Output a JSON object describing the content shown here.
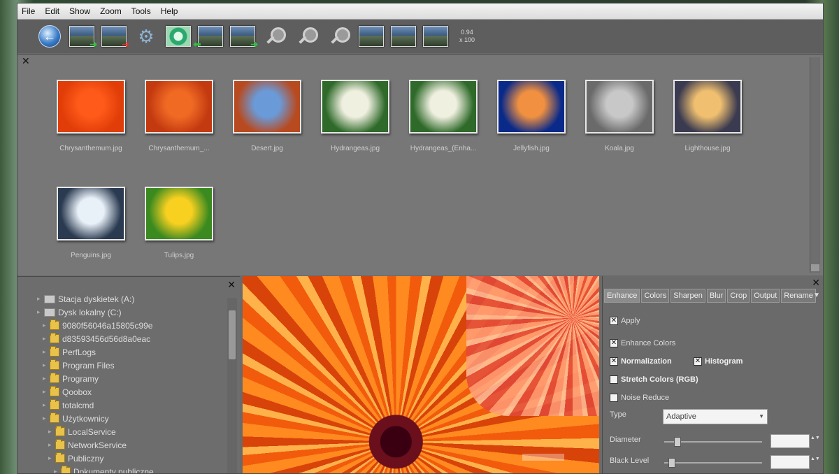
{
  "menu": [
    "File",
    "Edit",
    "Show",
    "Zoom",
    "Tools",
    "Help"
  ],
  "thumbnails": [
    {
      "label": "Chrysanthemum.jpg",
      "colors": [
        "#ff5a1a",
        "#e03d08"
      ]
    },
    {
      "label": "Chrysanthemum_...",
      "colors": [
        "#f06a24",
        "#c43a10"
      ]
    },
    {
      "label": "Desert.jpg",
      "colors": [
        "#6a9ad8",
        "#b84a20"
      ]
    },
    {
      "label": "Hydrangeas.jpg",
      "colors": [
        "#f0f0e0",
        "#2f6a2a"
      ]
    },
    {
      "label": "Hydrangeas_(Enha...",
      "colors": [
        "#f0f0e0",
        "#2f6a2a"
      ]
    },
    {
      "label": "Jellyfish.jpg",
      "colors": [
        "#f09040",
        "#0a2a8a"
      ]
    },
    {
      "label": "Koala.jpg",
      "colors": [
        "#c8c8c8",
        "#6a6a6a"
      ]
    },
    {
      "label": "Lighthouse.jpg",
      "colors": [
        "#f0c070",
        "#3a3a50"
      ]
    },
    {
      "label": "Penguins.jpg",
      "colors": [
        "#e8f0f8",
        "#2a3a50"
      ]
    },
    {
      "label": "Tulips.jpg",
      "colors": [
        "#f8d020",
        "#3a8a20"
      ]
    }
  ],
  "tree": [
    {
      "label": "Stacja dyskietek (A:)",
      "type": "drive",
      "indent": 1
    },
    {
      "label": "Dysk lokalny (C:)",
      "type": "drive",
      "indent": 1
    },
    {
      "label": "9080f56046a15805c99e",
      "type": "folder",
      "indent": 2
    },
    {
      "label": "d83593456d56d8a0eac",
      "type": "folder",
      "indent": 2
    },
    {
      "label": "PerfLogs",
      "type": "folder",
      "indent": 2
    },
    {
      "label": "Program Files",
      "type": "folder",
      "indent": 2
    },
    {
      "label": "Programy",
      "type": "folder",
      "indent": 2
    },
    {
      "label": "Qoobox",
      "type": "folder",
      "indent": 2
    },
    {
      "label": "totalcmd",
      "type": "folder",
      "indent": 2
    },
    {
      "label": "Użytkownicy",
      "type": "folder",
      "indent": 2
    },
    {
      "label": "LocalService",
      "type": "folder",
      "indent": 3
    },
    {
      "label": "NetworkService",
      "type": "folder",
      "indent": 3
    },
    {
      "label": "Publiczny",
      "type": "folder",
      "indent": 3
    },
    {
      "label": "Dokumenty publiczne",
      "type": "folder",
      "indent": 4
    }
  ],
  "tabs": [
    "Enhance",
    "Colors",
    "Sharpen",
    "Blur",
    "Crop",
    "Output",
    "Rename"
  ],
  "options": {
    "apply": "Apply",
    "enhance_colors": "Enhance Colors",
    "normalization": "Normalization",
    "histogram": "Histogram",
    "stretch_colors": "Stretch Colors (RGB)",
    "noise_reduce": "Noise Reduce"
  },
  "type_label": "Type",
  "type_value": "Adaptive",
  "diameter_label": "Diameter",
  "black_level_label": "Black Level",
  "zoom_readout": [
    "0.94",
    "x 100"
  ]
}
